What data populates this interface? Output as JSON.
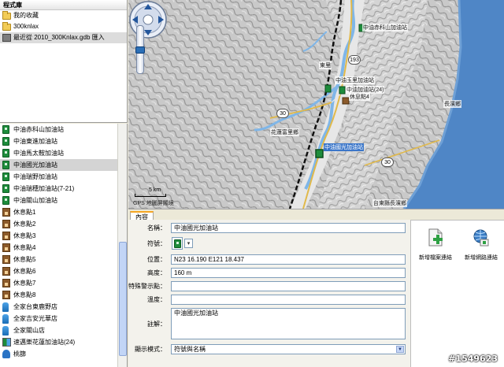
{
  "library": {
    "title": "程式庫",
    "items": [
      {
        "label": "我的收藏",
        "icon": "folder-icon"
      },
      {
        "label": "300knlax",
        "icon": "folder-icon"
      },
      {
        "label": "最近從 2010_300Knlax.gdb 匯入",
        "icon": "gpx-file-icon"
      }
    ]
  },
  "list": {
    "items": [
      {
        "label": "中油赤科山加油站",
        "icon": "gas"
      },
      {
        "label": "中油東進加油站",
        "icon": "gas"
      },
      {
        "label": "中油馬太鞍加油站",
        "icon": "gas"
      },
      {
        "label": "中油國光加油站",
        "icon": "gas",
        "selected": true
      },
      {
        "label": "中油瑞野加油站",
        "icon": "gas"
      },
      {
        "label": "中油瑞穗加油站(7-21)",
        "icon": "gas"
      },
      {
        "label": "中油關山加油站",
        "icon": "gas"
      },
      {
        "label": "休息點1",
        "icon": "rest"
      },
      {
        "label": "休息點2",
        "icon": "rest"
      },
      {
        "label": "休息點3",
        "icon": "rest"
      },
      {
        "label": "休息點4",
        "icon": "rest"
      },
      {
        "label": "休息點5",
        "icon": "rest"
      },
      {
        "label": "休息點6",
        "icon": "rest"
      },
      {
        "label": "休息點7",
        "icon": "rest"
      },
      {
        "label": "休息點8",
        "icon": "rest"
      },
      {
        "label": "全家台東鹿野店",
        "icon": "store"
      },
      {
        "label": "全家吉安光華店",
        "icon": "store"
      },
      {
        "label": "全家關山店",
        "icon": "store"
      },
      {
        "label": "速邁樂花蓮加油站(24)",
        "icon": "mixed"
      },
      {
        "label": "桃篩",
        "icon": "toilet"
      }
    ]
  },
  "map": {
    "labels": {
      "chike": "中油赤科山加油站",
      "guangfu": "中油玉里加油站",
      "yuli24": "中油加油站(24)",
      "rest4": "休息點4",
      "fuli": "花蓮富里鄉",
      "guoguang": "中油國光加油站",
      "changbin": "長濱鄉",
      "taitung": "台東縣長濱鄉",
      "dongli": "東里"
    },
    "shields": {
      "r193": "193",
      "r30a": "30",
      "r30b": "30"
    },
    "scale": "5 km",
    "copyright": "GPS 地圖屏顯境"
  },
  "tab": {
    "label": "內容"
  },
  "props": {
    "name_label": "名稱：",
    "name_value": "中油國光加油站",
    "symbol_label": "符號：",
    "position_label": "位置：",
    "position_value": "N23 16.190 E121 18.437",
    "altitude_label": "高度：",
    "altitude_value": "160 m",
    "proximity_label": "特殊警示點：",
    "proximity_value": "",
    "depth_label": "溫度：",
    "depth_value": "",
    "comment_label": "註解：",
    "comment_value": "中油國光加油站",
    "display_label": "顯示模式：",
    "display_value": "符號與名稱"
  },
  "actions": {
    "new_file_link": "新增檔案連結",
    "new_web_link": "新增網路連結"
  },
  "watermark": "#1549623",
  "colors": {
    "sea": "#4f86c6",
    "river": "#7fb6e8",
    "road": "#e1b94a",
    "selection": "#3b76c9"
  }
}
